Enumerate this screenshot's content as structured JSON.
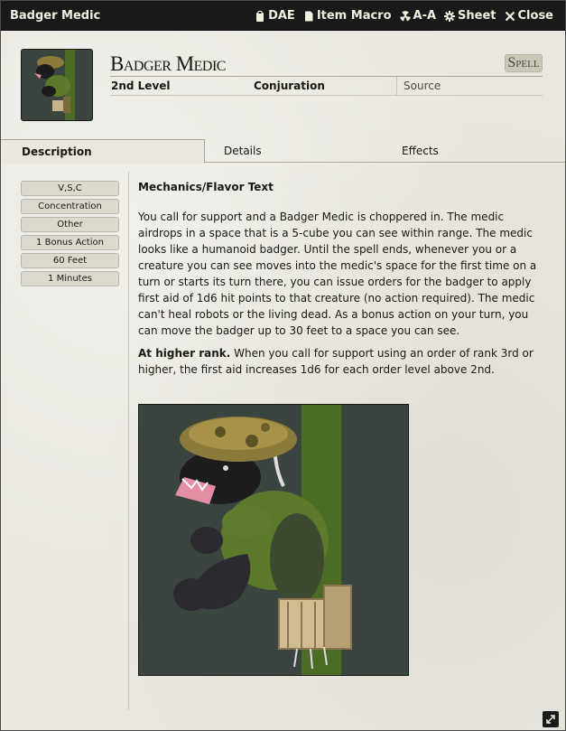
{
  "window": {
    "title": "Badger Medic",
    "header_buttons": [
      {
        "label": "DAE",
        "icon": "clipboard-icon"
      },
      {
        "label": "Item Macro",
        "icon": "file-icon"
      },
      {
        "label": "A-A",
        "icon": "radiation-icon"
      },
      {
        "label": "Sheet",
        "icon": "gear-icon"
      },
      {
        "label": "Close",
        "icon": "close-icon"
      }
    ]
  },
  "item": {
    "name": "Badger Medic",
    "type": "Spell",
    "level": "2nd Level",
    "school": "Conjuration",
    "source_placeholder": "Source"
  },
  "tabs": [
    {
      "label": "Description",
      "active": true
    },
    {
      "label": "Details",
      "active": false
    },
    {
      "label": "Effects",
      "active": false
    }
  ],
  "properties": [
    "V,S,C",
    "Concentration",
    "Other",
    "1 Bonus Action",
    "60 Feet",
    "1 Minutes"
  ],
  "description": {
    "heading": "Mechanics/Flavor Text",
    "body": "You call for support and a Badger Medic is choppered in.  The medic airdrops in a space that is a 5-cube you can see within range.  The medic looks like a humanoid badger.  Until the spell ends, whenever you or a creature you can see moves into the medic's space for the first time on a turn or starts its turn there, you can issue orders for the badger to apply first aid of 1d6 hit points to that creature (no action required). The medic can't heal robots or the living dead.  As a bonus action on your turn, you can move the badger up to 30 feet to a space you can see.",
    "higher_label": "At higher rank.",
    "higher_text": " When you call for support using an order of rank 3rd or higher, the first aid increases 1d6 for each order level above 2nd."
  },
  "art": {
    "subject": "badger medic illustration"
  },
  "colors": {
    "titlebar_bg": "#191919",
    "sheet_bg": "#e9e7df",
    "art_bg": "#3b4540",
    "art_stripe": "#4c6b25"
  }
}
